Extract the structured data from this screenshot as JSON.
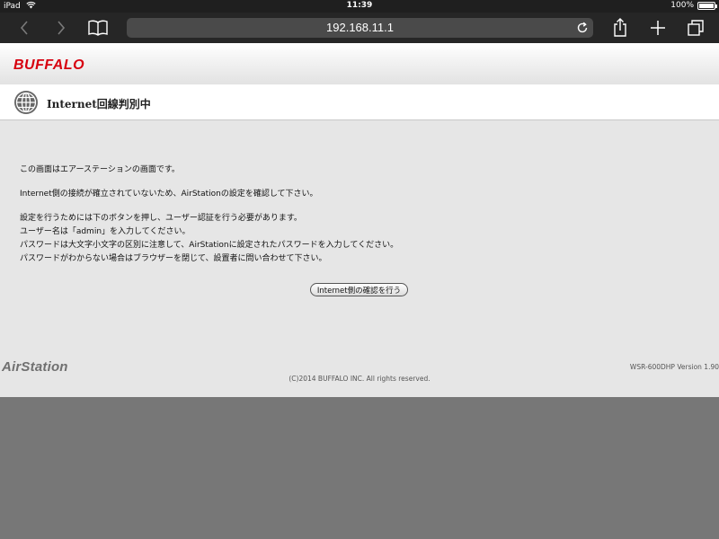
{
  "status_bar": {
    "device": "iPad",
    "time": "11:39",
    "battery": "100%",
    "battery_level": 1.0
  },
  "browser": {
    "url": "192.168.11.1",
    "icons": [
      "chevron-left-icon",
      "chevron-right-icon",
      "bookmarks-icon",
      "reload-icon",
      "share-icon",
      "plus-icon",
      "tabs-icon"
    ]
  },
  "header": {
    "logo": "BUFFALO",
    "title": "Internet回線判別中"
  },
  "content": {
    "line1": "この画面はエアーステーションの画面です。",
    "line2": "Internet側の接続が確立されていないため、AirStationの設定を確認して下さい。",
    "line3": "設定を行うためには下のボタンを押し、ユーザー認証を行う必要があります。",
    "line4": "ユーザー名は「admin」を入力してください。",
    "line5": "パスワードは大文字小文字の区別に注意して、AirStationに設定されたパスワードを入力してください。",
    "line6": "パスワードがわからない場合はブラウザーを閉じて、設置者に問い合わせて下さい。",
    "button_label": "Internet側の確認を行う"
  },
  "footer": {
    "product_logo": "AirStation",
    "version": "WSR-600DHP Version 1.90",
    "copyright": "(C)2014 BUFFALO INC. All rights reserved."
  },
  "colors": {
    "brand_red": "#d7000f",
    "page_bg": "#e6e6e6",
    "toolbar_bg": "#262626"
  }
}
